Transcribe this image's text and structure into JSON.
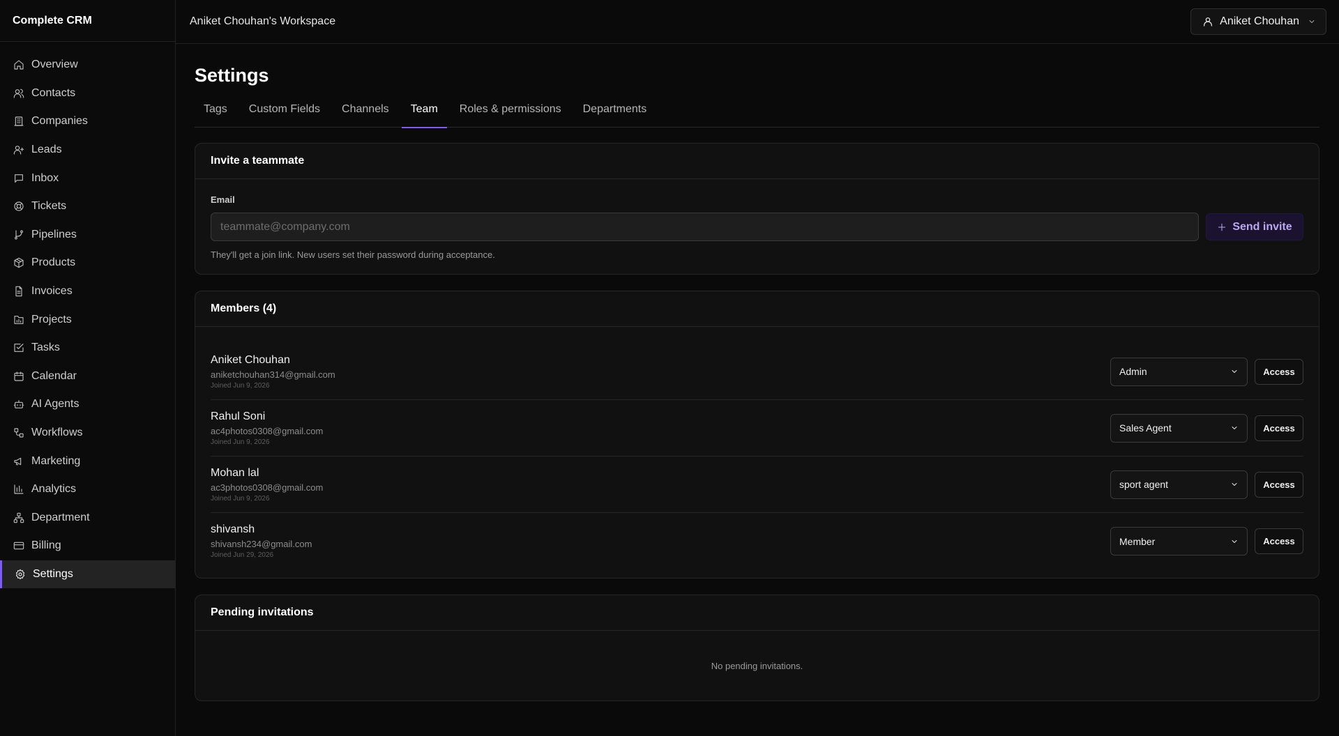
{
  "brand": "Complete CRM",
  "workspace": "Aniket Chouhan's Workspace",
  "user_menu": {
    "name": "Aniket Chouhan",
    "icon": "user-icon"
  },
  "sidebar": {
    "items": [
      {
        "label": "Overview",
        "icon": "home-icon"
      },
      {
        "label": "Contacts",
        "icon": "users-icon"
      },
      {
        "label": "Companies",
        "icon": "building-icon"
      },
      {
        "label": "Leads",
        "icon": "user-plus-icon"
      },
      {
        "label": "Inbox",
        "icon": "message-icon"
      },
      {
        "label": "Tickets",
        "icon": "lifebuoy-icon"
      },
      {
        "label": "Pipelines",
        "icon": "git-branch-icon"
      },
      {
        "label": "Products",
        "icon": "package-icon"
      },
      {
        "label": "Invoices",
        "icon": "file-text-icon"
      },
      {
        "label": "Projects",
        "icon": "folder-chart-icon"
      },
      {
        "label": "Tasks",
        "icon": "check-square-icon"
      },
      {
        "label": "Calendar",
        "icon": "calendar-icon"
      },
      {
        "label": "AI Agents",
        "icon": "bot-icon"
      },
      {
        "label": "Workflows",
        "icon": "workflow-icon"
      },
      {
        "label": "Marketing",
        "icon": "megaphone-icon"
      },
      {
        "label": "Analytics",
        "icon": "bar-chart-icon"
      },
      {
        "label": "Department",
        "icon": "network-icon"
      },
      {
        "label": "Billing",
        "icon": "credit-card-icon"
      },
      {
        "label": "Settings",
        "icon": "gear-icon"
      }
    ],
    "active": "Settings"
  },
  "page": {
    "title": "Settings"
  },
  "tabs": [
    {
      "label": "Tags"
    },
    {
      "label": "Custom Fields"
    },
    {
      "label": "Channels"
    },
    {
      "label": "Team"
    },
    {
      "label": "Roles & permissions"
    },
    {
      "label": "Departments"
    }
  ],
  "active_tab": "Team",
  "invite": {
    "title": "Invite a teammate",
    "email_label": "Email",
    "email_placeholder": "teammate@company.com",
    "email_value": "",
    "send_label": "Send invite",
    "help": "They'll get a join link. New users set their password during acceptance."
  },
  "members": {
    "title": "Members (4)",
    "access_label": "Access",
    "list": [
      {
        "name": "Aniket Chouhan",
        "email": "aniketchouhan314@gmail.com",
        "joined": "Joined Jun 9, 2026",
        "role": "Admin"
      },
      {
        "name": "Rahul Soni",
        "email": "ac4photos0308@gmail.com",
        "joined": "Joined Jun 9, 2026",
        "role": "Sales Agent"
      },
      {
        "name": "Mohan lal",
        "email": "ac3photos0308@gmail.com",
        "joined": "Joined Jun 9, 2026",
        "role": "sport agent"
      },
      {
        "name": "shivansh",
        "email": "shivansh234@gmail.com",
        "joined": "Joined Jun 29, 2026",
        "role": "Member"
      }
    ]
  },
  "pending": {
    "title": "Pending invitations",
    "empty": "No pending invitations."
  },
  "colors": {
    "accent": "#7c5cff",
    "background": "#0a0a0a",
    "card": "#111111",
    "send_button_bg": "#1b1230"
  }
}
